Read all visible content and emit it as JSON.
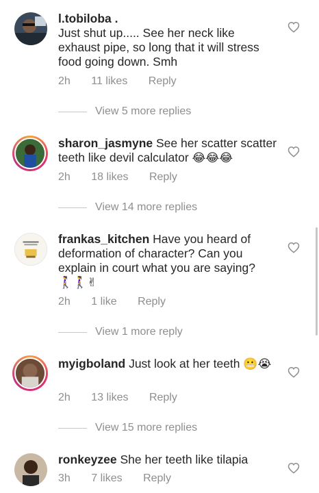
{
  "comments": [
    {
      "username": "l.tobiloba .",
      "text": "Just shut up..... See her neck like exhaust pipe, so long that it will stress food going down. Smh",
      "time": "2h",
      "likes": "11 likes",
      "reply": "Reply",
      "more_replies": "View 5 more replies"
    },
    {
      "username": "sharon_jasmyne",
      "text": " See her scatter scatter teeth like devil calculator ",
      "emoji": "😂😂😂",
      "time": "2h",
      "likes": "18 likes",
      "reply": "Reply",
      "more_replies": "View 14 more replies"
    },
    {
      "username": "frankas_kitchen",
      "text": " Have you heard of deformation of character? Can you explain in court what you are saying?",
      "emoji": "🚶‍♀️🚶‍♀️✌",
      "time": "2h",
      "likes": "1 like",
      "reply": "Reply",
      "more_replies": "View 1 more reply"
    },
    {
      "username": "myigboland",
      "text": " Just look at her teeth ",
      "emoji": "😬😭",
      "time": "2h",
      "likes": "13 likes",
      "reply": "Reply",
      "more_replies": "View 15 more replies"
    },
    {
      "username": "ronkeyzee",
      "text": " She her teeth like tilapia",
      "time": "3h",
      "likes": "7 likes",
      "reply": "Reply"
    }
  ],
  "colors": {
    "primary_text": "#262626",
    "secondary_text": "#8e8e8e",
    "divider": "#c7c7c7"
  },
  "icons": {
    "like": "heart-outline-icon"
  }
}
